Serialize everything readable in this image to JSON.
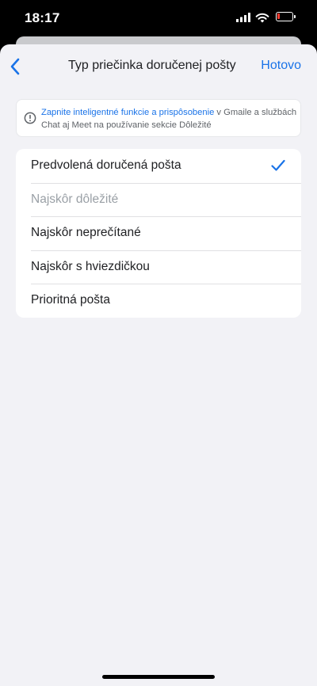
{
  "status_bar": {
    "time": "18:17"
  },
  "nav": {
    "back_icon": "chevron-left-icon",
    "title": "Typ priečinka doručenej pošty",
    "done_label": "Hotovo"
  },
  "info": {
    "icon": "info-circle-icon",
    "link_text": "Zapnite inteligentné funkcie a prispôsobenie",
    "text_rest": " v Gmaile a službách Chat aj Meet na používanie sekcie Dôležité"
  },
  "inbox_types": [
    {
      "label": "Predvolená doručená pošta",
      "selected": true,
      "disabled": false
    },
    {
      "label": "Najskôr dôležité",
      "selected": false,
      "disabled": true
    },
    {
      "label": "Najskôr neprečítané",
      "selected": false,
      "disabled": false
    },
    {
      "label": "Najskôr s hviezdičkou",
      "selected": false,
      "disabled": false
    },
    {
      "label": "Prioritná pošta",
      "selected": false,
      "disabled": false
    }
  ],
  "colors": {
    "accent": "#1a73e8",
    "background": "#f2f2f6",
    "disabled_text": "#9aa0a6",
    "battery_low": "#ff3b30"
  }
}
